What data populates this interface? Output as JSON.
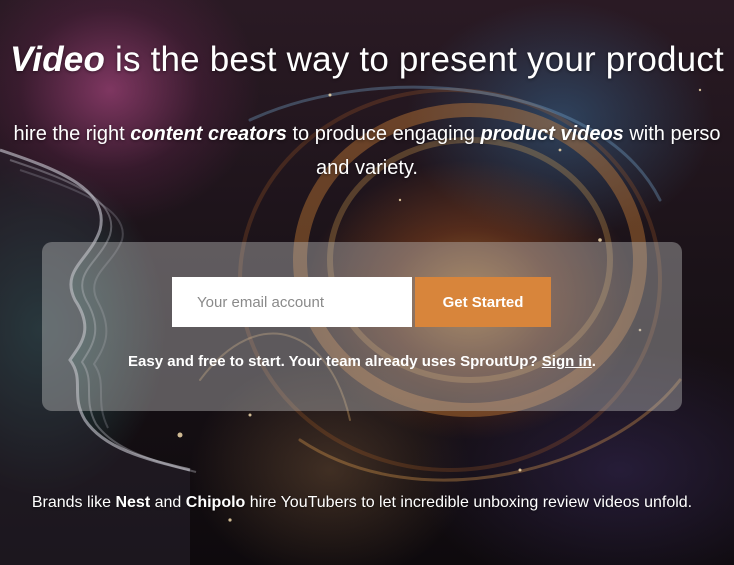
{
  "hero": {
    "title_emphasis": "Video",
    "title_rest": "is the best way to present your product",
    "subtitle_part1": "hire the right",
    "subtitle_emphasis1": "content creators",
    "subtitle_part2": "to produce engaging",
    "subtitle_emphasis2": "product videos",
    "subtitle_part3": "with perso",
    "subtitle_line2": "and variety."
  },
  "signup": {
    "email_placeholder": "Your email account",
    "email_value": "",
    "button_label": "Get Started",
    "note_text": "Easy and free to start. Your team already uses SproutUp?",
    "signin_link": "Sign in",
    "note_end": "."
  },
  "brands": {
    "prefix": "Brands like",
    "brand1": "Nest",
    "and": "and",
    "brand2": "Chipolo",
    "suffix": "hire YouTubers to let incredible unboxing review videos unfold."
  },
  "colors": {
    "cta": "#d8853b",
    "card": "rgba(190,190,190,0.42)"
  }
}
